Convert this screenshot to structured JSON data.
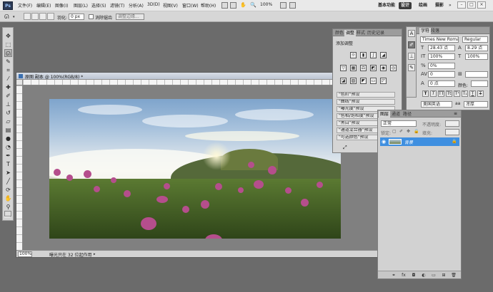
{
  "menubar": {
    "logo": "Ps",
    "items": [
      "文件(F)",
      "编辑(E)",
      "图像(I)",
      "图层(L)",
      "选择(S)",
      "滤镜(T)",
      "分析(A)",
      "3D(D)",
      "视图(V)",
      "窗口(W)",
      "帮助(H)"
    ],
    "zoom": "100%",
    "workspaces": [
      "基本功能",
      "设计",
      "绘画",
      "摄影"
    ],
    "window_buttons": [
      "–",
      "□",
      "×"
    ]
  },
  "options": {
    "feather_label": "羽化:",
    "feather_value": "0 px",
    "antialias_label": "消除锯齿",
    "refine_edge_label": "调整边缘..."
  },
  "document": {
    "title": "原图 副本 @ 100%(RGB/8) *",
    "zoom": "100%",
    "status": "曝光只在 32 位起作用"
  },
  "adjustments": {
    "tabs": [
      "颜色",
      "调整",
      "样式",
      "历史记录"
    ],
    "heading": "添加调整",
    "presets": [
      "\"色阶\"预设",
      "\"曲线\"预设",
      "\"曝光度\"预设",
      "\"色相/饱和度\"预设",
      "\"黑白\"预设",
      "\"通道混合器\"预设",
      "\"可选颜色\"预设"
    ]
  },
  "character": {
    "tabs": [
      "字符",
      "段落"
    ],
    "font_family": "Times New Roman",
    "font_style": "Regular",
    "font_size": "28.43 点",
    "leading": "8.29 点",
    "vertical_scale": "100%",
    "horizontal_scale": "100%",
    "tracking": "0%",
    "kerning": "0",
    "baseline_shift": "0 点",
    "color_label": "颜色:",
    "language": "美国英语",
    "antialias": "浑厚"
  },
  "layers": {
    "tabs": [
      "图层",
      "通道",
      "路径"
    ],
    "blend_mode": "正常",
    "opacity_label": "不透明度:",
    "fill_label": "填充:",
    "lock_label": "锁定:",
    "layer_name": "背景"
  },
  "colors": {
    "accent": "#3f8fe0",
    "background": "#6b6b6b"
  }
}
